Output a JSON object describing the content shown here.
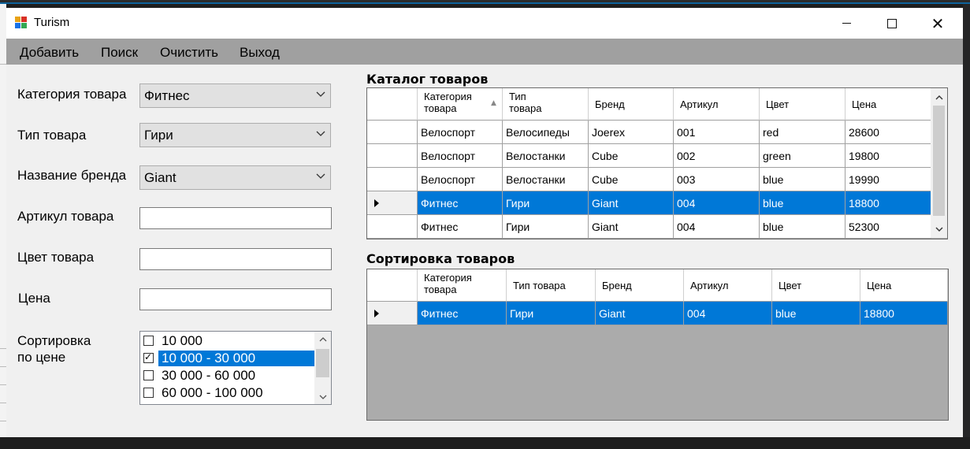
{
  "window": {
    "title": "Turism"
  },
  "menu": {
    "items": [
      "Добавить",
      "Поиск",
      "Очистить",
      "Выход"
    ]
  },
  "form": {
    "category_label": "Категория товара",
    "category_value": "Фитнес",
    "type_label": "Тип товара",
    "type_value": "Гири",
    "brand_label": "Название бренда",
    "brand_value": "Giant",
    "article_label": "Артикул товара",
    "article_value": "",
    "color_label": "Цвет товара",
    "color_value": "",
    "price_label": "Цена",
    "price_value": "",
    "sort_label_line1": "Сортировка",
    "sort_label_line2": "по цене",
    "price_ranges": [
      {
        "label": "10 000",
        "checked": false,
        "selected": false
      },
      {
        "label": "10 000 - 30 000",
        "checked": true,
        "selected": true
      },
      {
        "label": "30 000 - 60 000",
        "checked": false,
        "selected": false
      },
      {
        "label": "60 000 - 100 000",
        "checked": false,
        "selected": false
      }
    ]
  },
  "catalog": {
    "title": "Каталог товаров",
    "columns": [
      "Категория\nтовара",
      "Тип\nтовара",
      "Бренд",
      "Артикул",
      "Цвет",
      "Цена"
    ],
    "rows": [
      [
        "Велоспорт",
        "Велосипеды",
        "Joerex",
        "001",
        "red",
        "28600"
      ],
      [
        "Велоспорт",
        "Велостанки",
        "Cube",
        "002",
        "green",
        "19800"
      ],
      [
        "Велоспорт",
        "Велостанки",
        "Cube",
        "003",
        "blue",
        "19990"
      ],
      [
        "Фитнес",
        "Гири",
        "Giant",
        "004",
        "blue",
        "18800"
      ],
      [
        "Фитнес",
        "Гири",
        "Giant",
        "004",
        "blue",
        "52300"
      ]
    ],
    "selected_row": 3
  },
  "sorting": {
    "title": "Сортировка товаров",
    "columns": [
      "Категория\nтовара",
      "Тип товара",
      "Бренд",
      "Артикул",
      "Цвет",
      "Цена"
    ],
    "rows": [
      [
        "Фитнес",
        "Гири",
        "Giant",
        "004",
        "blue",
        "18800"
      ]
    ],
    "selected_row": 0
  },
  "colors": {
    "selection": "#0078d7",
    "menubar": "#a0a0a0",
    "grid_empty": "#ababab"
  }
}
